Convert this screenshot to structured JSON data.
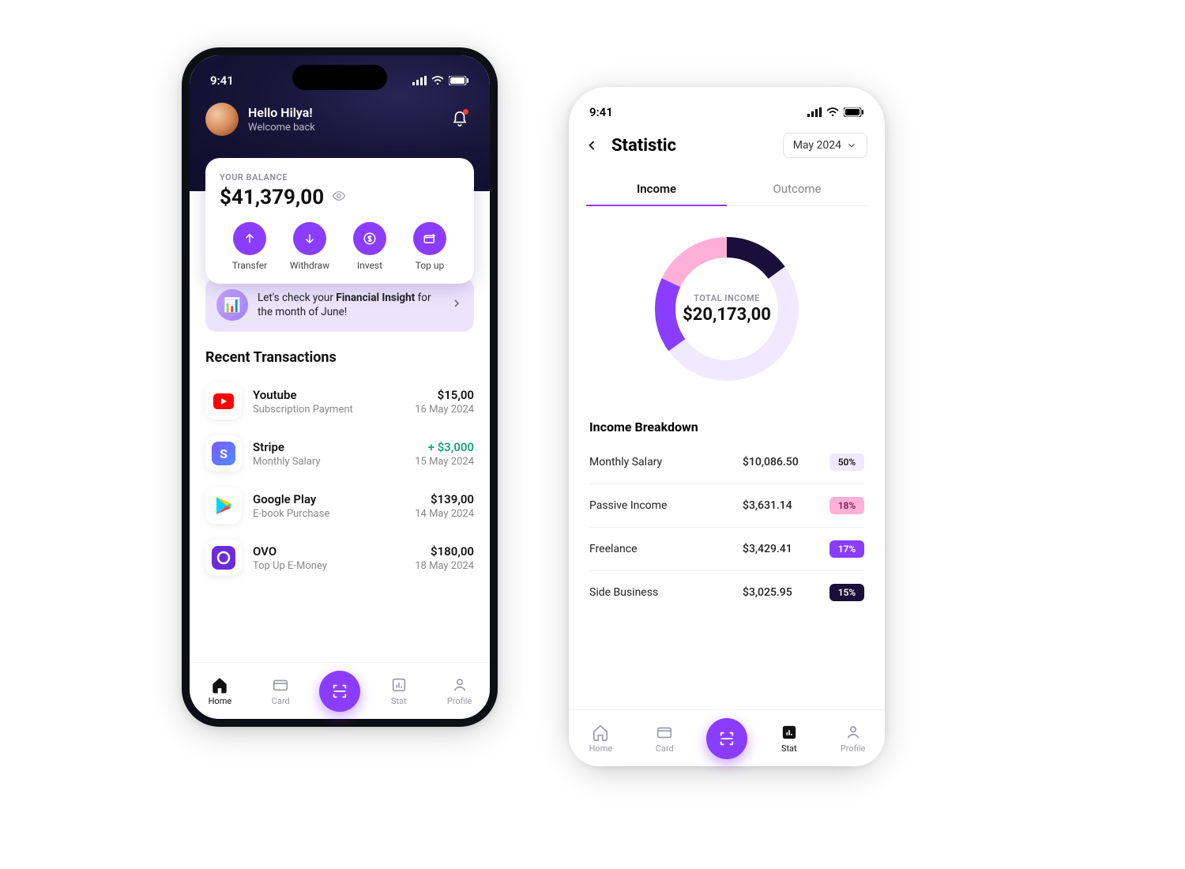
{
  "status_time": "9:41",
  "home": {
    "greeting_title": "Hello Hilya!",
    "greeting_sub": "Welcome back",
    "balance_label": "YOUR BALANCE",
    "balance_amount": "$41,379,00",
    "actions": [
      {
        "label": "Transfer"
      },
      {
        "label": "Withdraw"
      },
      {
        "label": "Invest"
      },
      {
        "label": "Top up"
      }
    ],
    "insight_pre": "Let's check your ",
    "insight_bold": "Financial Insight",
    "insight_post": " for the month of June!",
    "recent_title": "Recent Transactions",
    "transactions": [
      {
        "name": "Youtube",
        "sub": "Subscription Payment",
        "amount": "$15,00",
        "date": "16 May 2024",
        "positive": false
      },
      {
        "name": "Stripe",
        "sub": "Monthly Salary",
        "amount": "+ $3,000",
        "date": "15 May 2024",
        "positive": true
      },
      {
        "name": "Google Play",
        "sub": "E-book Purchase",
        "amount": "$139,00",
        "date": "14 May 2024",
        "positive": false
      },
      {
        "name": "OVO",
        "sub": "Top Up E-Money",
        "amount": "$180,00",
        "date": "18 May 2024",
        "positive": false
      }
    ],
    "nav": {
      "home": "Home",
      "card": "Card",
      "stat": "Stat",
      "profile": "Profile"
    }
  },
  "stat": {
    "title": "Statistic",
    "period": "May 2024",
    "tabs": {
      "income": "Income",
      "outcome": "Outcome"
    },
    "donut_label": "TOTAL INCOME",
    "donut_value": "$20,173,00",
    "breakdown_title": "Income Breakdown",
    "rows": [
      {
        "name": "Monthly Salary",
        "amount": "$10,086.50",
        "pct": "50%",
        "bg": "#efeaff",
        "fg": "#111"
      },
      {
        "name": "Passive Income",
        "amount": "$3,631.14",
        "pct": "18%",
        "bg": "#ffb0d7",
        "fg": "#7a1f52"
      },
      {
        "name": "Freelance",
        "amount": "$3,429.41",
        "pct": "17%",
        "bg": "#8b3dff",
        "fg": "#fff"
      },
      {
        "name": "Side Business",
        "amount": "$3,025.95",
        "pct": "15%",
        "bg": "#1a0f3a",
        "fg": "#fff"
      }
    ]
  },
  "chart_data": {
    "type": "pie",
    "title": "TOTAL INCOME",
    "total_label": "$20,173,00",
    "series": [
      {
        "name": "Monthly Salary",
        "value": 10086.5,
        "pct": 50,
        "color": "#efeaff"
      },
      {
        "name": "Passive Income",
        "value": 3631.14,
        "pct": 18,
        "color": "#ffb0d7"
      },
      {
        "name": "Freelance",
        "value": 3429.41,
        "pct": 17,
        "color": "#8b3dff"
      },
      {
        "name": "Side Business",
        "value": 3025.95,
        "pct": 15,
        "color": "#1a0f3a"
      }
    ]
  }
}
